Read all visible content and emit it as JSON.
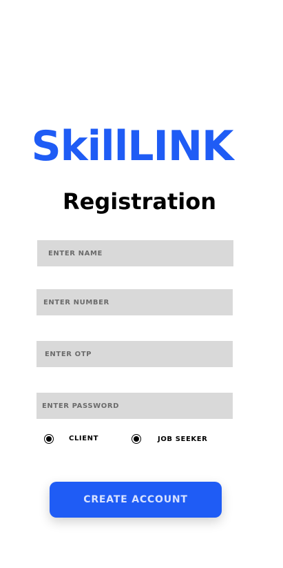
{
  "brand": {
    "name": "SkillLINK",
    "color": "#1f5cf5"
  },
  "page": {
    "title": "Registration"
  },
  "form": {
    "name": {
      "value": "",
      "placeholder": "ENTER NAME"
    },
    "number": {
      "value": "",
      "placeholder": "ENTER NUMBER"
    },
    "otp": {
      "value": "",
      "placeholder": "ENTER OTP"
    },
    "password": {
      "value": "",
      "placeholder": "ENTER PASSWORD"
    },
    "roles": [
      {
        "label": "CLIENT",
        "selected": true
      },
      {
        "label": "JOB SEEKER",
        "selected": true
      }
    ],
    "submit_label": "CREATE ACCOUNT"
  }
}
